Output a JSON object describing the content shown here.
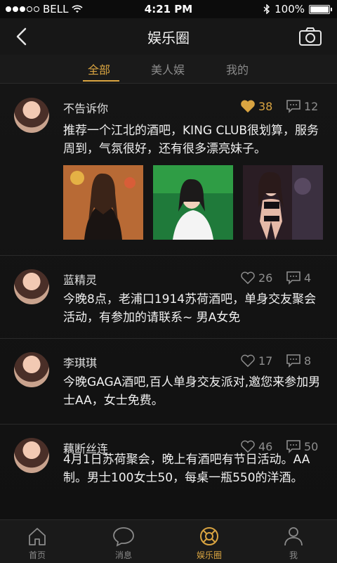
{
  "status_bar": {
    "carrier": "BELL",
    "time": "4:21 PM",
    "battery": "100%",
    "battery_level": 1.0
  },
  "navbar": {
    "title": "娱乐圈",
    "back_icon": "chevron-left-icon",
    "camera_icon": "camera-icon"
  },
  "tabs": [
    {
      "label": "全部",
      "active": true
    },
    {
      "label": "美人娱",
      "active": false
    },
    {
      "label": "我的",
      "active": false
    }
  ],
  "posts": [
    {
      "user": "不告诉你",
      "likes": "38",
      "comments": "12",
      "liked": true,
      "text": "推荐一个江北的酒吧，KING CLUB很划算，服务周到，气氛很好，还有很多漂亮妹子。",
      "photos": [
        "bar-photo-1",
        "bar-photo-2",
        "bar-photo-3"
      ]
    },
    {
      "user": "蓝精灵",
      "likes": "26",
      "comments": "4",
      "liked": false,
      "text": "今晚8点，老浦口1914苏荷酒吧，单身交友聚会活动，有参加的请联系~ 男A女免"
    },
    {
      "user": "李琪琪",
      "likes": "17",
      "comments": "8",
      "liked": false,
      "text": "今晚GAGA酒吧,百人单身交友派对,邀您来参加男士AA，女士免费。"
    },
    {
      "user": "藕断丝连",
      "likes": "46",
      "comments": "50",
      "liked": false,
      "text": "4月1日苏荷聚会，晚上有酒吧有节日活动。AA制。男士100女士50，每桌一瓶550的洋酒。"
    }
  ],
  "tab_bar": [
    {
      "label": "首页",
      "icon": "home-icon",
      "active": false
    },
    {
      "label": "消息",
      "icon": "message-icon",
      "active": false
    },
    {
      "label": "娱乐圈",
      "icon": "lifebuoy-icon",
      "active": true
    },
    {
      "label": "我",
      "icon": "person-icon",
      "active": false
    }
  ],
  "colors": {
    "accent": "#d9a441",
    "background": "#121212"
  }
}
